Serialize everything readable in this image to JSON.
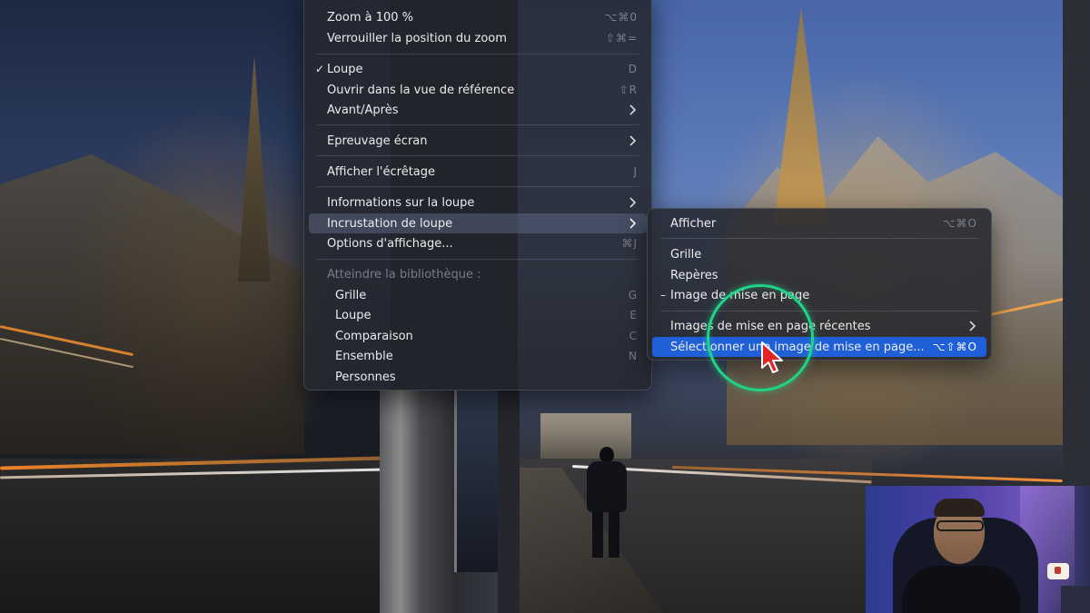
{
  "main_menu": {
    "items": [
      {
        "label": "Zoom à 100 %",
        "shortcut": "⌥⌘0"
      },
      {
        "label": "Verrouiller la position du zoom",
        "shortcut": "⇧⌘="
      },
      {
        "label": "Loupe",
        "shortcut": "D",
        "checked": true
      },
      {
        "label": "Ouvrir dans la vue de référence",
        "shortcut": "⇧R"
      },
      {
        "label": "Avant/Après",
        "submenu": true
      },
      {
        "label": "Epreuvage écran",
        "submenu": true
      },
      {
        "label": "Afficher l'écrêtage",
        "shortcut": "J"
      },
      {
        "label": "Informations sur la loupe",
        "submenu": true
      },
      {
        "label": "Incrustation de loupe",
        "submenu": true,
        "highlighted": true
      },
      {
        "label": "Options d'affichage...",
        "shortcut": "⌘J"
      },
      {
        "label": "Atteindre la bibliothèque :",
        "disabled": true
      },
      {
        "label": "Grille",
        "shortcut": "G"
      },
      {
        "label": "Loupe",
        "shortcut": "E"
      },
      {
        "label": "Comparaison",
        "shortcut": "C"
      },
      {
        "label": "Ensemble",
        "shortcut": "N"
      },
      {
        "label": "Personnes"
      }
    ],
    "check_glyph": "✓"
  },
  "sub_menu": {
    "items": [
      {
        "label": "Afficher",
        "shortcut": "⌥⌘O"
      },
      {
        "label": "Grille"
      },
      {
        "label": "Repères"
      },
      {
        "label": "Image de mise en page",
        "dash": true
      },
      {
        "label": "Images de mise en page récentes",
        "submenu": true
      },
      {
        "label": "Sélectionner une image de mise en page...",
        "shortcut": "⌥⇧⌘O",
        "highlighted": true
      }
    ],
    "dash_glyph": "–"
  },
  "colors": {
    "highlight": "#1f5fd8",
    "cursor_ring": "#1fd387",
    "cursor_arrow": "#e0262b"
  },
  "icons": {
    "submenu": "chevron-right-icon",
    "checkmark": "checkmark-icon",
    "cursor": "mouse-pointer-icon"
  }
}
